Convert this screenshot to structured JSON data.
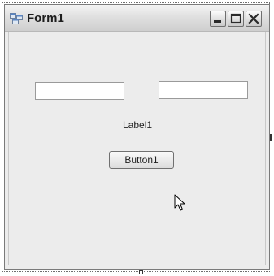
{
  "window": {
    "title": "Form1"
  },
  "title_buttons": {
    "minimize": "minimize-icon",
    "maximize": "maximize-icon",
    "close": "close-icon"
  },
  "form": {
    "textbox1_value": "",
    "textbox2_value": "",
    "label1_text": "Label1",
    "button1_label": "Button1"
  },
  "colors": {
    "client_background": "#ececec",
    "titlebar_background": "#dcdcdc",
    "text": "#222222"
  }
}
